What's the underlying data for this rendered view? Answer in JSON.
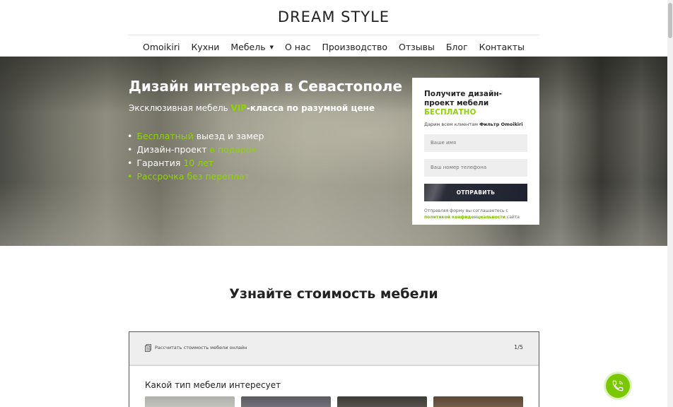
{
  "header": {
    "logo": "DREAM STYLE",
    "nav": [
      {
        "label": "Omoikiri"
      },
      {
        "label": "Кухни"
      },
      {
        "label": "Мебель"
      },
      {
        "label": "О нас"
      },
      {
        "label": "Производство"
      },
      {
        "label": "Отзывы"
      },
      {
        "label": "Блог"
      },
      {
        "label": "Контакты"
      }
    ]
  },
  "hero": {
    "title": "Дизайн интерьера в Севастополе",
    "subtitle_pre": "Эксклюзивная мебель ",
    "subtitle_vip": "VIP",
    "subtitle_post": "-класса по разумной цене",
    "bullets": [
      {
        "accent": "Бесплатный",
        "rest": " выезд и замер"
      },
      {
        "pre": "Дизайн-проект ",
        "accent": "в подарок"
      },
      {
        "pre": "Гарантия ",
        "accent": "10 лет"
      },
      {
        "accent": "Рассрочка без переплат"
      }
    ]
  },
  "form": {
    "title": "Получите дизайн-проект мебели ",
    "title_accent": "БЕСПЛАТНО",
    "gift_pre": "Дарим всем клиентам ",
    "gift_bold": "Фильтр Omoikiri",
    "name_placeholder": "Ваше имя",
    "phone_placeholder": "Ваш номер телефона",
    "submit": "ОТПРАВИТЬ",
    "policy_pre": "Отправляя форму вы соглашаетесь с ",
    "policy_link": "политикой конфиденциальности",
    "policy_post": " сайта"
  },
  "section": {
    "title": "Узнайте стоимость мебели"
  },
  "quiz": {
    "header_label": "Рассчитать стоимость мебели онлайн",
    "counter": "1/5",
    "question": "Какой тип мебели интересует"
  },
  "colors": {
    "accent": "#8fd400",
    "call_button": "#7ac800"
  },
  "icons": {
    "quiz": "document-icon",
    "call": "phone-icon"
  }
}
